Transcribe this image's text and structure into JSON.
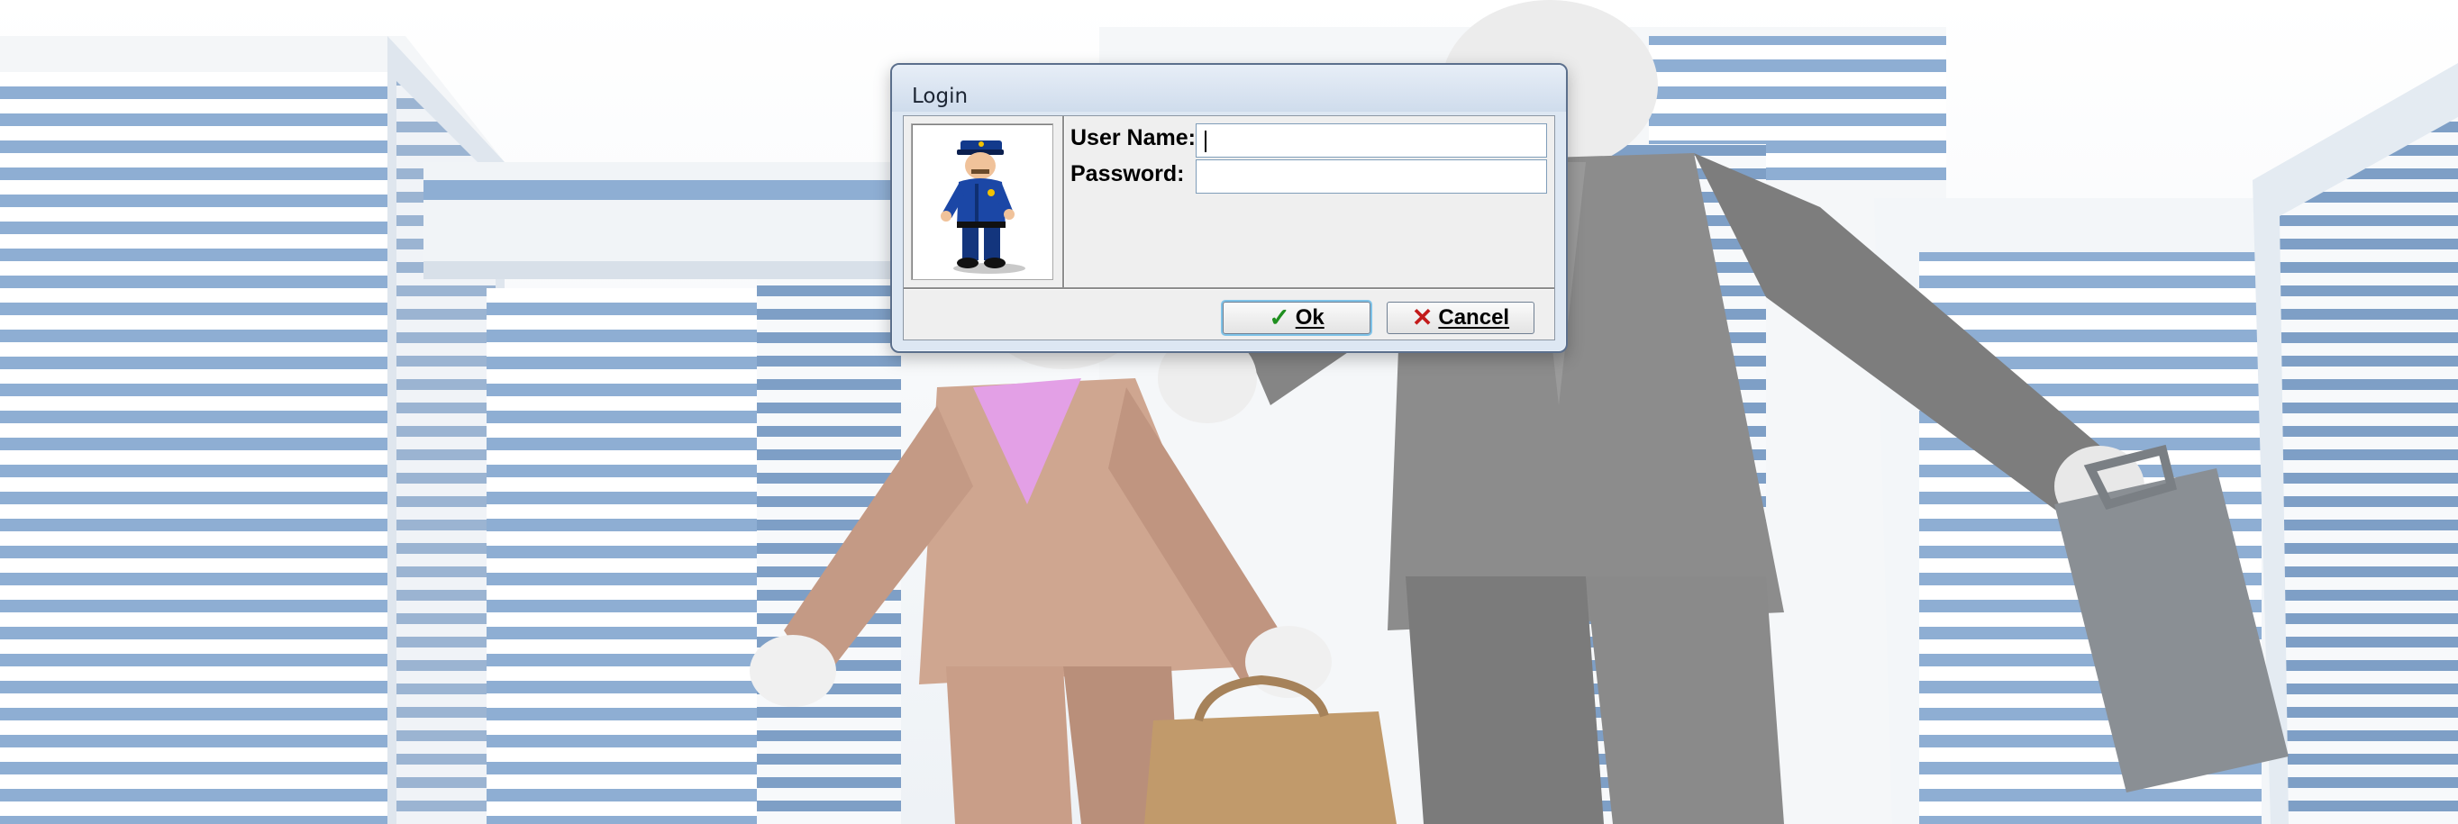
{
  "dialog": {
    "title": "Login",
    "image_icon": "police-officer-mascot",
    "user_name_label": "User Name:",
    "password_label": "Password:",
    "user_name_value": "",
    "password_value": "",
    "ok_label": "Ok",
    "ok_icon": "check-icon",
    "cancel_label": "Cancel",
    "cancel_icon": "x-icon"
  },
  "colors": {
    "ok_check": "#1f8f1f",
    "cancel_x": "#c31b1b",
    "dialog_frame": "#dde7f3",
    "building_glass": "#7f9fc4"
  }
}
